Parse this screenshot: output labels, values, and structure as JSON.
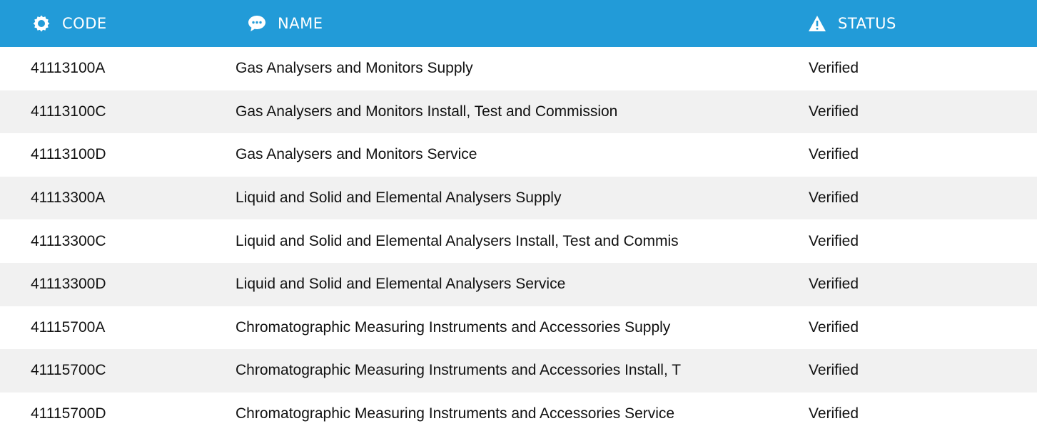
{
  "header": {
    "code_label": "CODE",
    "name_label": "NAME",
    "status_label": "STATUS",
    "code_icon": "gear-icon",
    "name_icon": "chat-bubble-icon",
    "status_icon": "warning-icon"
  },
  "colors": {
    "header_bg": "#229bd8",
    "header_text": "#ffffff",
    "stripe": "#f1f1f1"
  },
  "rows": [
    {
      "code": "41113100A",
      "name": "Gas Analysers and Monitors Supply",
      "status": "Verified"
    },
    {
      "code": "41113100C",
      "name": "Gas Analysers and Monitors Install, Test and Commission",
      "status": "Verified"
    },
    {
      "code": "41113100D",
      "name": "Gas Analysers and Monitors Service",
      "status": "Verified"
    },
    {
      "code": "41113300A",
      "name": "Liquid and Solid and Elemental Analysers Supply",
      "status": "Verified"
    },
    {
      "code": "41113300C",
      "name": "Liquid and Solid and Elemental Analysers Install, Test and Commis",
      "status": "Verified"
    },
    {
      "code": "41113300D",
      "name": "Liquid and Solid and Elemental Analysers Service",
      "status": "Verified"
    },
    {
      "code": "41115700A",
      "name": "Chromatographic Measuring Instruments and Accessories Supply",
      "status": "Verified"
    },
    {
      "code": "41115700C",
      "name": "Chromatographic Measuring Instruments and Accessories Install, T",
      "status": "Verified"
    },
    {
      "code": "41115700D",
      "name": "Chromatographic Measuring Instruments and Accessories Service",
      "status": "Verified"
    }
  ]
}
